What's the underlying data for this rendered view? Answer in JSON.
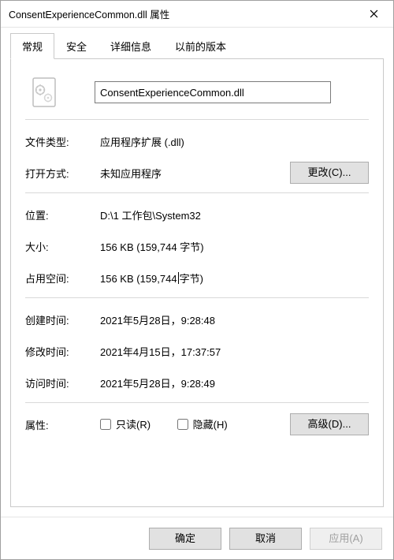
{
  "window": {
    "title": "ConsentExperienceCommon.dll 属性"
  },
  "tabs": {
    "general": "常规",
    "security": "安全",
    "details": "详细信息",
    "previous": "以前的版本"
  },
  "filename": "ConsentExperienceCommon.dll",
  "labels": {
    "filetype": "文件类型:",
    "opens_with": "打开方式:",
    "location": "位置:",
    "size": "大小:",
    "size_on_disk": "占用空间:",
    "created": "创建时间:",
    "modified": "修改时间:",
    "accessed": "访问时间:",
    "attributes": "属性:"
  },
  "values": {
    "filetype": "应用程序扩展 (.dll)",
    "opens_with": "未知应用程序",
    "location": "D:\\1 工作包\\System32",
    "size": "156 KB (159,744 字节)",
    "size_on_disk_a": "156 KB (159,744",
    "size_on_disk_b": "字节)",
    "created": "2021年5月28日，9:28:48",
    "modified": "2021年4月15日，17:37:57",
    "accessed": "2021年5月28日，9:28:49"
  },
  "buttons": {
    "change": "更改(C)...",
    "advanced": "高级(D)...",
    "ok": "确定",
    "cancel": "取消",
    "apply": "应用(A)"
  },
  "checkboxes": {
    "readonly": "只读(R)",
    "hidden": "隐藏(H)"
  }
}
